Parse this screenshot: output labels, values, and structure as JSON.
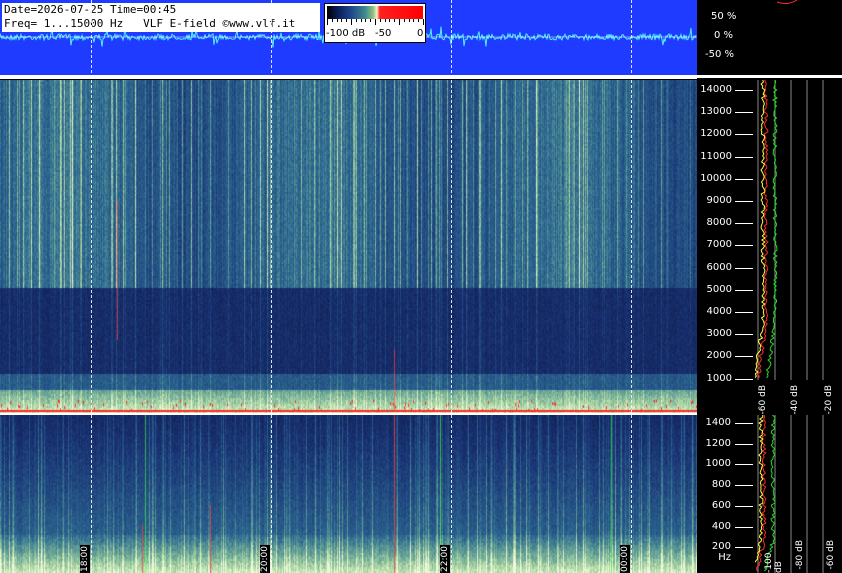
{
  "info": {
    "line1": "Date=2026-07-25 Time=00:45",
    "line2": "Freq= 1...15000 Hz   VLF E-field ©www.vlf.it"
  },
  "colorbar": {
    "labels": [
      "-100 dB",
      "-50",
      "0"
    ]
  },
  "waveform_scale": [
    "50 %",
    "0 %",
    "-50 %"
  ],
  "freq_axis_top": [
    "14000",
    "13000",
    "12000",
    "11000",
    "10000",
    "9000",
    "8000",
    "7000",
    "6000",
    "5000",
    "4000",
    "3000",
    "2000",
    "1000"
  ],
  "freq_axis_bottom": [
    "1400",
    "1200",
    "1000",
    "800",
    "600",
    "400",
    "200 Hz"
  ],
  "time_markers": [
    "18:00",
    "20:00",
    "22:00",
    "00:00"
  ],
  "side_db_labels_top": [
    "-60 dB",
    "-40 dB",
    "-20 dB"
  ],
  "side_db_labels_bottom": [
    "-100 dB",
    "-80 dB",
    "-60 dB"
  ],
  "colors": {
    "waveform_bg": "#1f3bff",
    "trace": "#4ff0ff",
    "spectrum_low": "#0a1a4a",
    "spectrum_mid": "#2f6a9a",
    "spectrum_high": "#9fe0a0",
    "red_line": "#ff2a2a",
    "green_line": "#22dd22",
    "yellow_line": "#ffff40"
  }
}
